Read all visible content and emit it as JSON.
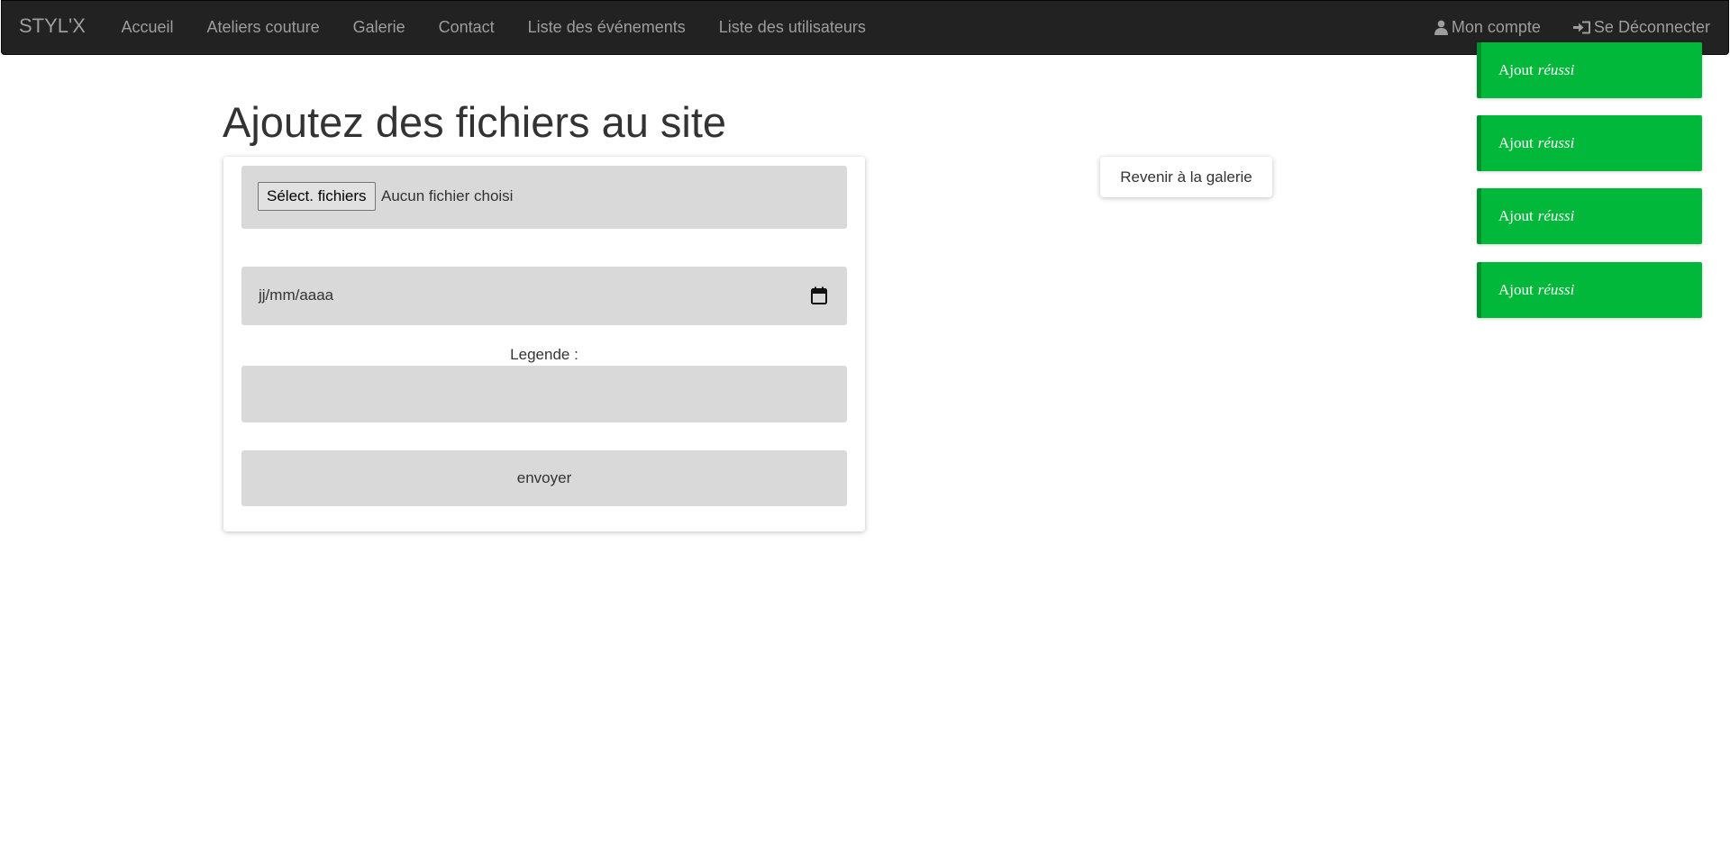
{
  "navbar": {
    "brand": "STYL'X",
    "left_items": [
      {
        "label": "Accueil"
      },
      {
        "label": "Ateliers couture"
      },
      {
        "label": "Galerie"
      },
      {
        "label": "Contact"
      },
      {
        "label": "Liste des événements"
      },
      {
        "label": "Liste des utilisateurs"
      }
    ],
    "right_items": [
      {
        "label": "Mon compte",
        "icon": "user-icon"
      },
      {
        "label": "Se Déconnecter",
        "icon": "log-in-icon"
      }
    ]
  },
  "main": {
    "title": "Ajoutez des fichiers au site",
    "form": {
      "file_button_label": "Sélect. fichiers",
      "file_status": "Aucun fichier choisi",
      "date_placeholder": "jj/mm/aaaa",
      "date_icon": "calendar-icon",
      "legend_label": "Legende :",
      "legend_value": "",
      "submit_label": "envoyer"
    },
    "back_button_label": "Revenir à la galerie"
  },
  "toasts": [
    {
      "prefix": "Ajout",
      "emphasis": "réussi"
    },
    {
      "prefix": "Ajout",
      "emphasis": "réussi"
    },
    {
      "prefix": "Ajout",
      "emphasis": "réussi"
    },
    {
      "prefix": "Ajout",
      "emphasis": "réussi"
    }
  ],
  "colors": {
    "navbar_bg": "#222222",
    "nav_text": "#9d9d9d",
    "field_bg": "#d9d9d9",
    "toast_bg": "#02b83a",
    "toast_border": "#02912e"
  }
}
